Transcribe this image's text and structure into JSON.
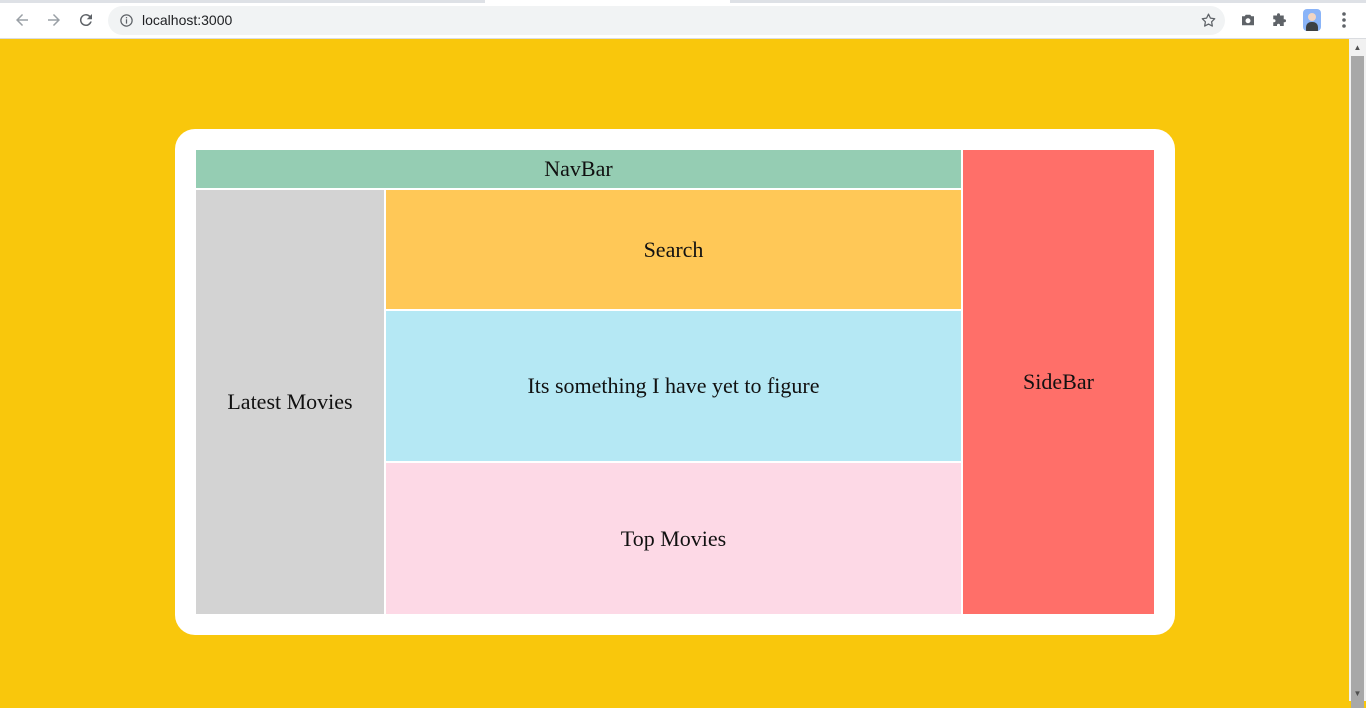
{
  "browser": {
    "url": "localhost:3000",
    "icons": {
      "back": "arrow-left-icon",
      "forward": "arrow-right-icon",
      "reload": "reload-icon",
      "info": "info-icon",
      "bookmark": "star-icon",
      "screenshot": "camera-icon",
      "extensions": "puzzle-icon",
      "menu": "kebab-menu-icon"
    }
  },
  "colors": {
    "page_background": "#f9c70c",
    "navbar": "#95cdb3",
    "sidebar": "#ff6f69",
    "latest_movies": "#d3d3d3",
    "search": "#ffc857",
    "figure": "#b5e8f4",
    "top_movies": "#fdd9e6"
  },
  "layout_grid": {
    "navbar": "NavBar",
    "sidebar": "SideBar",
    "latest_movies": "Latest Movies",
    "search": "Search",
    "figure": "Its something I have yet to figure",
    "top_movies": "Top Movies"
  }
}
